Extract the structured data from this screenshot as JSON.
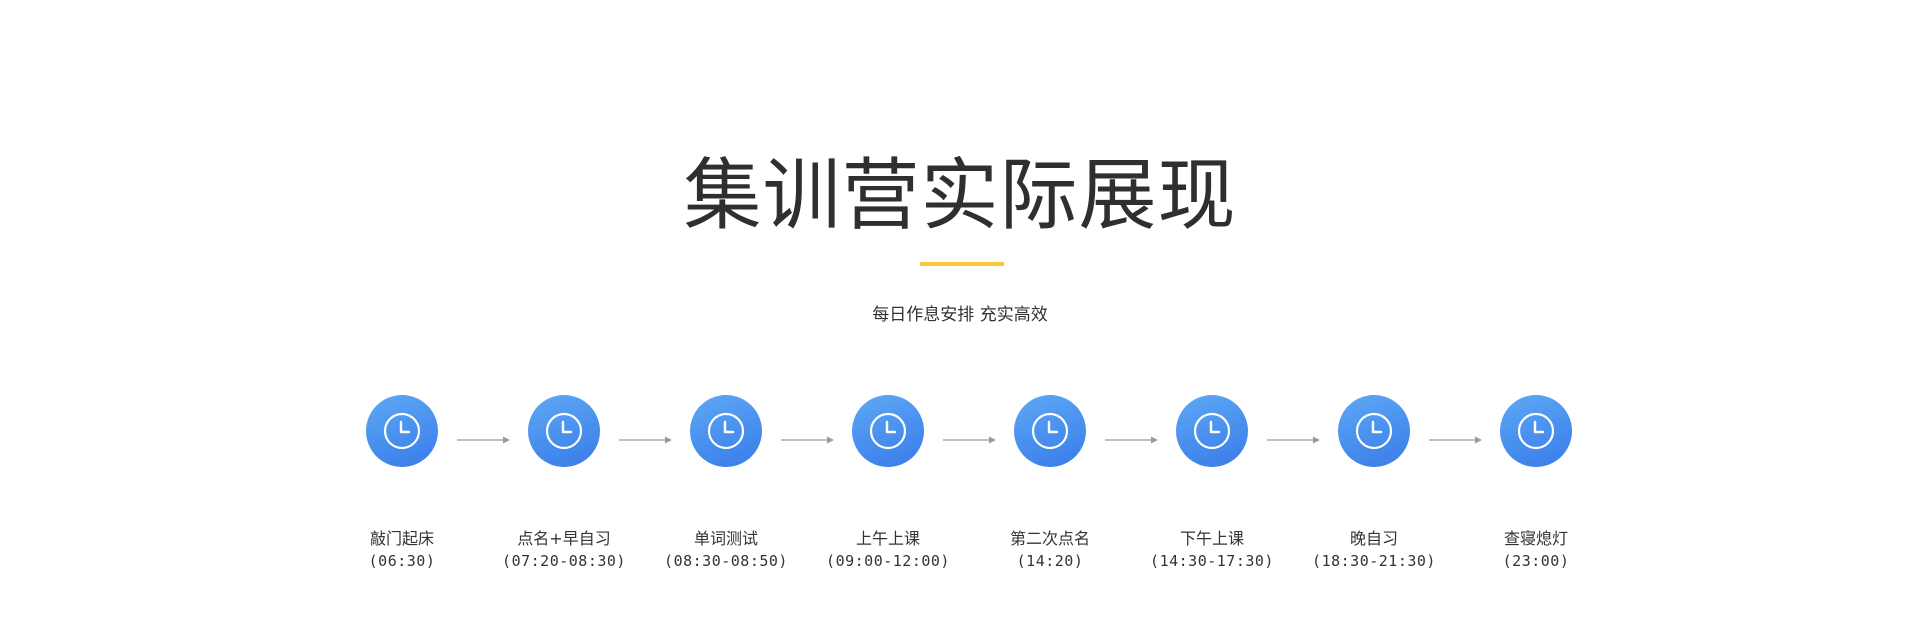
{
  "header": {
    "title": "集训营实际展现",
    "subtitle": "每日作息安排 充实高效",
    "accent_color": "#f7c83a"
  },
  "timeline": {
    "icon": "clock-icon",
    "circle_color": "#4a92ef",
    "steps": [
      {
        "label": "敲门起床",
        "time": "(06:30)"
      },
      {
        "label": "点名+早自习",
        "time": "(07:20-08:30)"
      },
      {
        "label": "单词测试",
        "time": "(08:30-08:50)"
      },
      {
        "label": "上午上课",
        "time": "(09:00-12:00)"
      },
      {
        "label": "第二次点名",
        "time": "(14:20)"
      },
      {
        "label": "下午上课",
        "time": "(14:30-17:30)"
      },
      {
        "label": "晚自习",
        "time": "(18:30-21:30)"
      },
      {
        "label": "查寝熄灯",
        "time": "(23:00)"
      }
    ]
  }
}
